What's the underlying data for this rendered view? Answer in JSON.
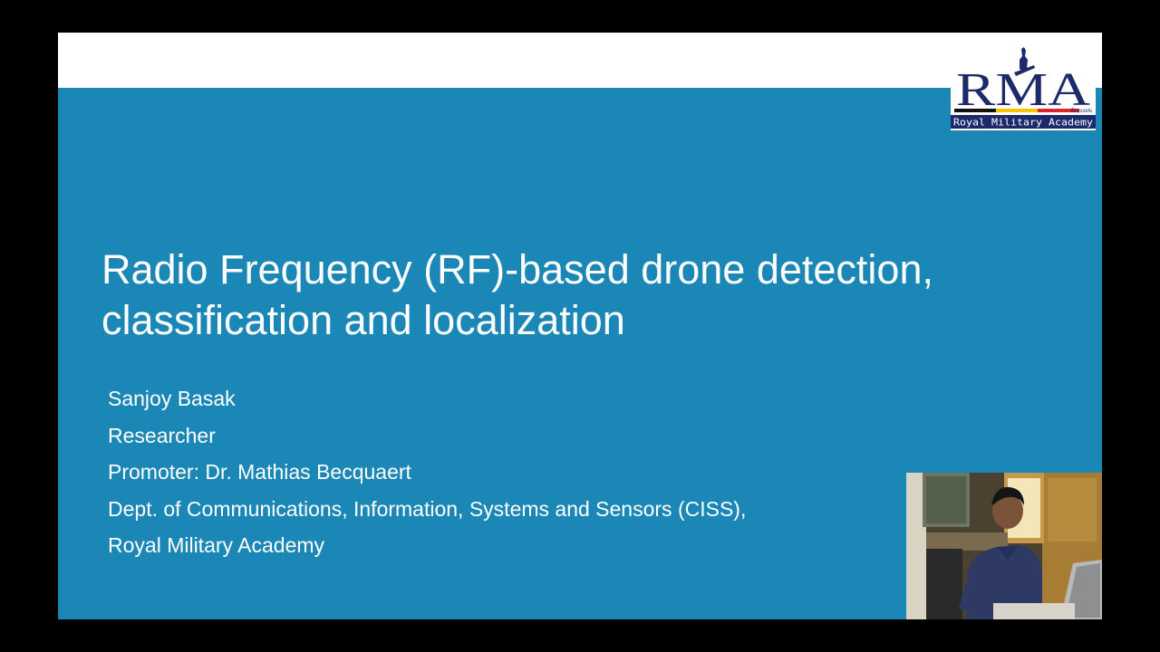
{
  "slide": {
    "title_lines": [
      "Radio Frequency (RF)-based drone detection,",
      "classification and localization"
    ],
    "presenter_name": "Sanjoy Basak",
    "presenter_role": "Researcher",
    "promoter": "Promoter: Dr. Mathias Becquaert",
    "department": "Dept. of Communications, Information, Systems and Sensors (CISS),",
    "institution": "Royal Military Academy"
  },
  "logo": {
    "letters": "RMA",
    "city": "Brussels",
    "caption": "Royal Military Academy"
  },
  "colors": {
    "slide_background": "#1a87b6",
    "frame_background": "#000000",
    "logo_navy": "#1c2a6b",
    "flag_black": "#111111",
    "flag_yellow": "#f2c500",
    "flag_red": "#d9262c"
  },
  "icons": {
    "logo": "rma-crest-logo",
    "webcam": "presenter-webcam-feed"
  }
}
